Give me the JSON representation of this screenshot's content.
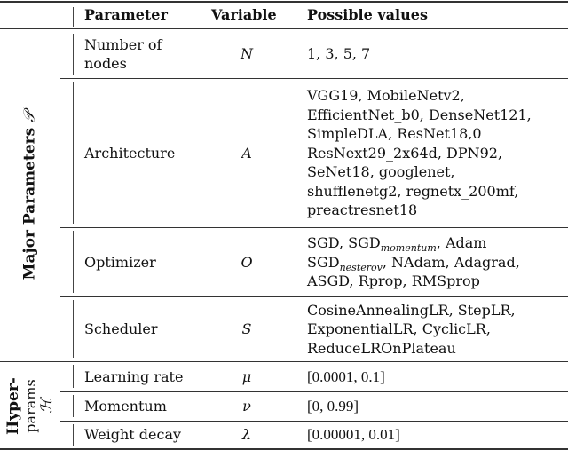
{
  "table": {
    "headers": {
      "parameter": "Parameter",
      "variable": "Variable",
      "possible_values": "Possible values"
    },
    "groups": [
      {
        "label": "Major Parameters",
        "symbol": "𝒫",
        "rows": [
          {
            "parameter": "Number of nodes",
            "variable": "N",
            "values": "1, 3, 5, 7"
          },
          {
            "parameter": "Architecture",
            "variable": "A",
            "values": [
              "VGG19, MobileNetv2,",
              "EfficientNet_b0, DenseNet121,",
              "SimpleDLA, ResNet18,0",
              "ResNext29_2x64d, DPN92,",
              "SeNet18, googlenet,",
              "shufflenetg2, regnetx_200mf,",
              "preactresnet18"
            ]
          },
          {
            "parameter": "Optimizer",
            "variable": "O",
            "values": {
              "l1a": "SGD, SGD",
              "l1sub": "momentum",
              "l1b": ", Adam",
              "l2a": "SGD",
              "l2sub": "nesterov",
              "l2b": ", NAdam, Adagrad,",
              "l3": "ASGD, Rprop, RMSprop"
            }
          },
          {
            "parameter": "Scheduler",
            "variable": "S",
            "values": [
              "CosineAnnealingLR, StepLR,",
              "ExponentialLR, CyclicLR,",
              "ReduceLROnPlateau"
            ]
          }
        ]
      },
      {
        "label_line1": "Hyper-",
        "label_line2": "params",
        "symbol": "ℋ",
        "rows": [
          {
            "parameter": "Learning rate",
            "variable": "μ",
            "values": "[0.0001, 0.1]"
          },
          {
            "parameter": "Momentum",
            "variable": "ν",
            "values": "[0, 0.99]"
          },
          {
            "parameter": "Weight decay",
            "variable": "λ",
            "values": "[0.00001, 0.01]"
          }
        ]
      }
    ]
  }
}
